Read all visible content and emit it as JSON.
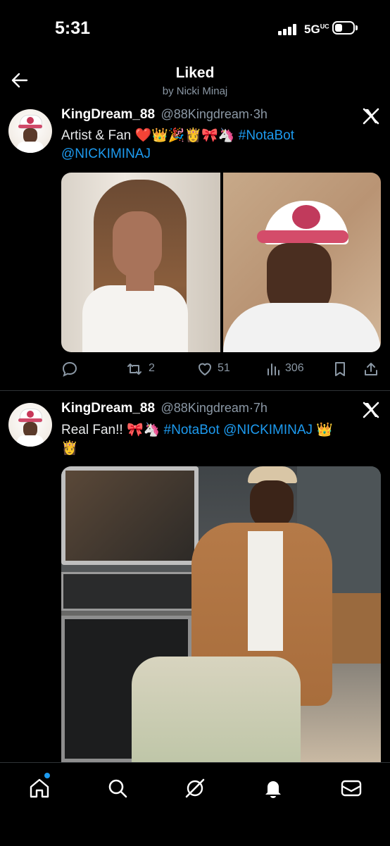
{
  "status_bar": {
    "time": "5:31",
    "network": "5G",
    "network_sup": "UC"
  },
  "header": {
    "title": "Liked",
    "subtitle": "by Nicki Minaj",
    "back_icon": "back-arrow-icon"
  },
  "tweets": [
    {
      "name": "KingDream_88",
      "handle": "@88Kingdream",
      "time": "3h",
      "text_plain": "Artist & Fan",
      "emojis": "❤️👑🎉👸🎀🦄",
      "hashtag": "#NotaBot",
      "mention": "@NICKIMINAJ",
      "stats": {
        "replies": "",
        "retweets": "2",
        "likes": "51",
        "views": "306"
      }
    },
    {
      "name": "KingDream_88",
      "handle": "@88Kingdream",
      "time": "7h",
      "text_plain": "Real Fan!!",
      "emojis": "🎀🦄",
      "hashtag": "#NotaBot",
      "mention": "@NICKIMINAJ",
      "emojis_end": "👑",
      "emoji_line2": "👸"
    }
  ],
  "nav": {
    "items": [
      "home-icon",
      "search-icon",
      "grok-icon",
      "notifications-icon",
      "messages-icon"
    ]
  },
  "colors": {
    "background": "#000000",
    "link": "#1d9bf0",
    "secondary": "#8b98a5",
    "divider": "#2f3336",
    "notification_dot": "#1d9bf0"
  }
}
